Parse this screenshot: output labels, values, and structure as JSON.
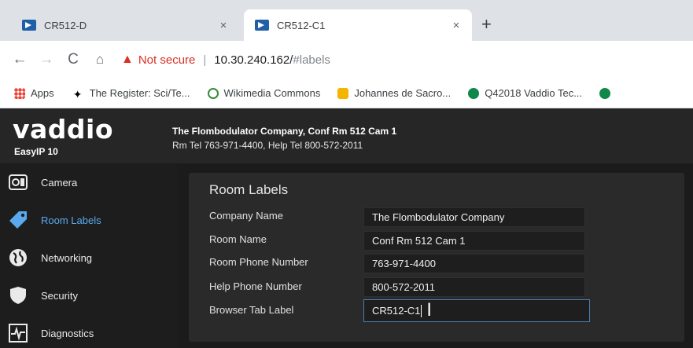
{
  "browser": {
    "tabs": [
      {
        "title": "CR512-D",
        "close": "×",
        "active": false
      },
      {
        "title": "CR512-C1",
        "close": "×",
        "active": true
      }
    ],
    "new_tab": "+",
    "nav": {
      "back": "←",
      "forward": "→",
      "reload": "C",
      "home": "⌂"
    },
    "address": {
      "warning_icon": "▲",
      "security_text": "Not secure",
      "separator": "|",
      "host": "10.30.240.162/",
      "hash": "#labels"
    },
    "bookmarks": [
      {
        "label": "Apps",
        "icon": "apps-grid-icon"
      },
      {
        "label": "The Register: Sci/Te...",
        "icon": "register-icon"
      },
      {
        "label": "Wikimedia Commons",
        "icon": "wikimedia-icon"
      },
      {
        "label": "Johannes de Sacro...",
        "icon": "bookmark-icon"
      },
      {
        "label": "Q42018 Vaddio Tec...",
        "icon": "sharepoint-icon"
      }
    ]
  },
  "app": {
    "logo": "vaddio",
    "model": "EasyIP 10",
    "header_line1": "The Flombodulator Company, Conf Rm 512 Cam 1",
    "header_line2": "Rm Tel 763-971-4400, Help Tel 800-572-2011",
    "accent_color": "#5aa9ef",
    "sidebar": [
      {
        "label": "Camera",
        "icon": "camera-icon",
        "active": false
      },
      {
        "label": "Room Labels",
        "icon": "tag-icon",
        "active": true
      },
      {
        "label": "Networking",
        "icon": "globe-icon",
        "active": false
      },
      {
        "label": "Security",
        "icon": "shield-icon",
        "active": false
      },
      {
        "label": "Diagnostics",
        "icon": "pulse-icon",
        "active": false
      }
    ],
    "panel": {
      "title": "Room Labels",
      "rows": [
        {
          "label": "Company Name",
          "value": "The Flombodulator Company"
        },
        {
          "label": "Room Name",
          "value": "Conf Rm 512 Cam 1"
        },
        {
          "label": "Room Phone Number",
          "value": "763-971-4400"
        },
        {
          "label": "Help Phone Number",
          "value": "800-572-2011"
        },
        {
          "label": "Browser Tab Label",
          "value": "CR512-C1"
        }
      ]
    }
  }
}
